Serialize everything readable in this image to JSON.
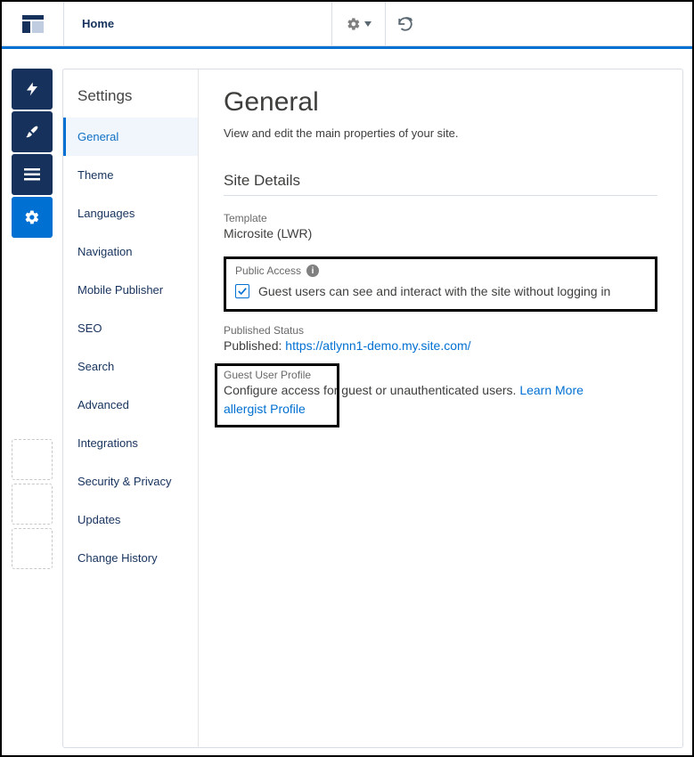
{
  "topbar": {
    "home_label": "Home"
  },
  "settings": {
    "title": "Settings",
    "items": [
      {
        "label": "General"
      },
      {
        "label": "Theme"
      },
      {
        "label": "Languages"
      },
      {
        "label": "Navigation"
      },
      {
        "label": "Mobile Publisher"
      },
      {
        "label": "SEO"
      },
      {
        "label": "Search"
      },
      {
        "label": "Advanced"
      },
      {
        "label": "Integrations"
      },
      {
        "label": "Security & Privacy"
      },
      {
        "label": "Updates"
      },
      {
        "label": "Change History"
      }
    ]
  },
  "content": {
    "heading": "General",
    "subtitle": "View and edit the main properties of your site.",
    "section_header": "Site Details",
    "template_label": "Template",
    "template_value": "Microsite (LWR)",
    "public_access_label": "Public Access",
    "public_access_checkbox_label": "Guest users can see and interact with the site without logging in",
    "published_status_label": "Published Status",
    "published_prefix": "Published: ",
    "published_url": "https://atlynn1-demo.my.site.com/",
    "guest_profile_label": "Guest User Profile",
    "guest_profile_text": "Configure access for guest or unauthenticated users. ",
    "guest_profile_learn_more": "Learn More",
    "guest_profile_link": "allergist Profile"
  }
}
